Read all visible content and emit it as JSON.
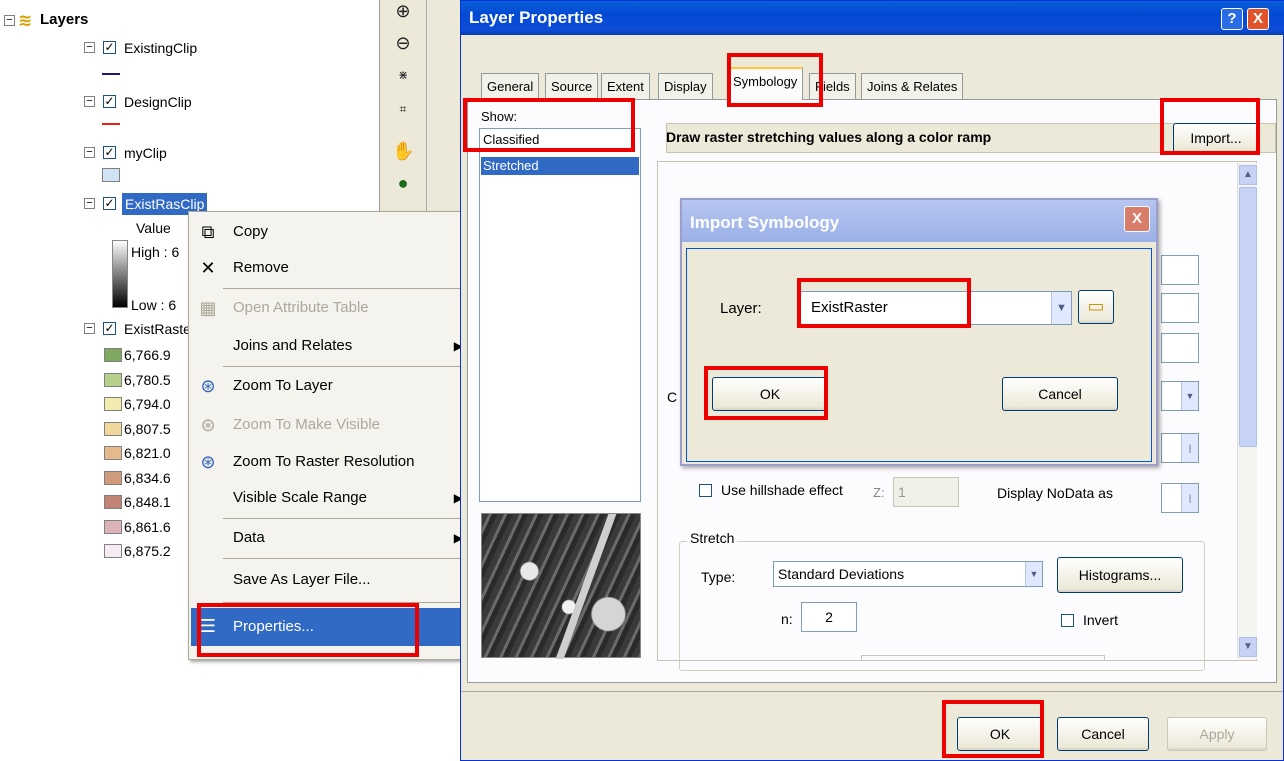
{
  "toc": {
    "root_label": "Layers",
    "layers": [
      {
        "name": "ExistingClip",
        "symbol": "line",
        "color": "#1a1a80"
      },
      {
        "name": "DesignClip",
        "symbol": "line",
        "color": "#e8201c"
      },
      {
        "name": "myClip",
        "symbol": "fill",
        "color": "#cfe3f5"
      }
    ],
    "raster_clip": {
      "name": "ExistRasClip",
      "value_label": "Value",
      "high_label": "High : 6",
      "low_label": "Low : 6"
    },
    "exist_raster": {
      "name": "ExistRaster",
      "classes": [
        {
          "label": "6,766.9",
          "color": "#7fa860"
        },
        {
          "label": "6,780.5",
          "color": "#b6cf8b"
        },
        {
          "label": "6,794.0",
          "color": "#f1ebb0"
        },
        {
          "label": "6,807.5",
          "color": "#f1d79c"
        },
        {
          "label": "6,821.0",
          "color": "#e6b98d"
        },
        {
          "label": "6,834.6",
          "color": "#cf9b7c"
        },
        {
          "label": "6,848.1",
          "color": "#c08375"
        },
        {
          "label": "6,861.6",
          "color": "#deb3b8"
        },
        {
          "label": "6,875.2",
          "color": "#f7ecf4"
        }
      ]
    }
  },
  "context_menu": {
    "items": [
      {
        "label": "Copy",
        "icon": "copy-icon",
        "disabled": false
      },
      {
        "label": "Remove",
        "icon": "remove-icon",
        "disabled": false
      },
      {
        "label": "Open Attribute Table",
        "icon": "table-icon",
        "disabled": true
      },
      {
        "label": "Joins and Relates",
        "icon": "",
        "disabled": false,
        "submenu": true
      },
      {
        "label": "Zoom To Layer",
        "icon": "zoom-to-layer-icon",
        "disabled": false
      },
      {
        "label": "Zoom To Make Visible",
        "icon": "zoom-visible-icon",
        "disabled": true
      },
      {
        "label": "Zoom To Raster Resolution",
        "icon": "zoom-raster-icon",
        "disabled": false
      },
      {
        "label": "Visible Scale Range",
        "icon": "",
        "disabled": false,
        "submenu": true
      },
      {
        "label": "Data",
        "icon": "",
        "disabled": false,
        "submenu": true
      },
      {
        "label": "Save As Layer File...",
        "icon": "",
        "disabled": false
      },
      {
        "label": "Properties...",
        "icon": "properties-icon",
        "disabled": false,
        "highlighted": true
      }
    ]
  },
  "layer_properties": {
    "title": "Layer Properties",
    "help_label": "?",
    "close_label": "X",
    "tabs": [
      "General",
      "Source",
      "Extent",
      "Display",
      "Symbology",
      "Fields",
      "Joins & Relates"
    ],
    "active_tab": "Symbology",
    "show_label": "Show:",
    "show_items": [
      "Classified",
      "Stretched"
    ],
    "selected_show": "Stretched",
    "description": "Draw raster stretching values along a color ramp",
    "import_button": "Import...",
    "hillshade_label": "Use hillshade effect",
    "z_label": "Z:",
    "z_value": "1",
    "nodata_label": "Display NoData as",
    "c_label": "C",
    "stretch_group": "Stretch",
    "type_label": "Type:",
    "type_value": "Standard Deviations",
    "histograms_button": "Histograms...",
    "n_label": "n:",
    "n_value": "2",
    "invert_label": "Invert",
    "ok_button": "OK",
    "cancel_button": "Cancel",
    "apply_button": "Apply"
  },
  "import_symbology": {
    "title": "Import Symbology",
    "close_label": "X",
    "layer_label": "Layer:",
    "layer_value": "ExistRaster",
    "ok_button": "OK",
    "cancel_button": "Cancel"
  }
}
